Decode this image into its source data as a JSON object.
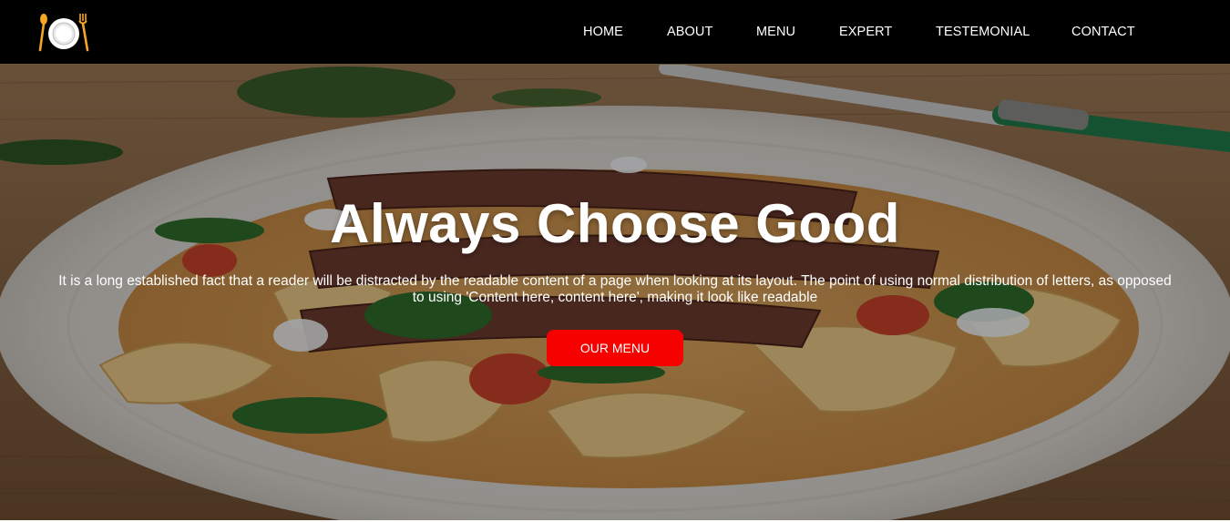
{
  "brand": {
    "logo_icon": "plate-fork-spoon-logo-icon",
    "accent": "#f5a623"
  },
  "nav": {
    "items": [
      {
        "label": "HOME"
      },
      {
        "label": "ABOUT"
      },
      {
        "label": "MENU"
      },
      {
        "label": "EXPERT"
      },
      {
        "label": "TESTEMONIAL"
      },
      {
        "label": "CONTACT"
      }
    ]
  },
  "hero": {
    "background_icon": "pasta-steak-plate-photo",
    "headline": "Always Choose Good",
    "lead": "It is a long established fact that a reader will be distracted by the readable content of a page when looking at its layout. The point of using normal distribution of letters, as opposed to using 'Content here, content here', making it look like readable",
    "cta_label": "OUR MENU",
    "cta_color": "#f70000"
  }
}
